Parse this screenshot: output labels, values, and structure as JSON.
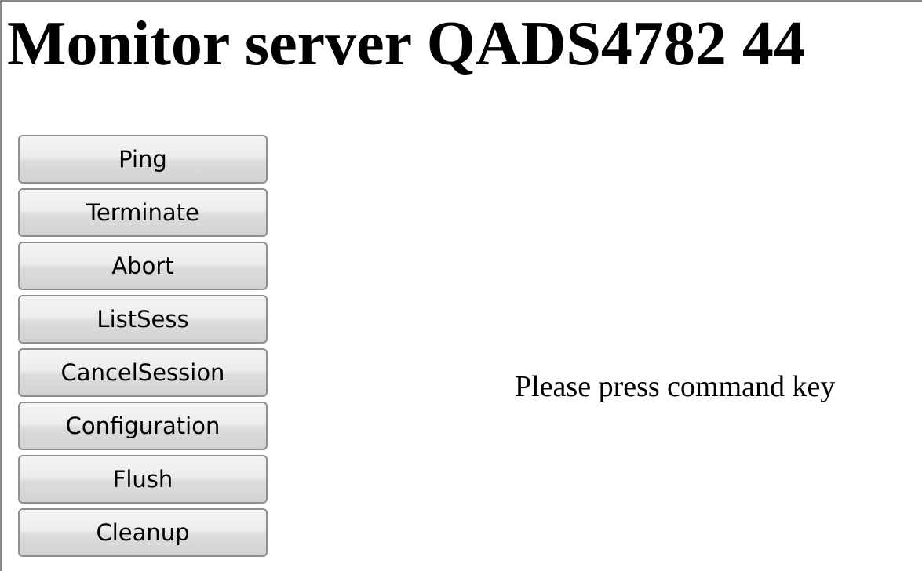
{
  "header": {
    "title": "Monitor server QADS4782 44"
  },
  "commands": {
    "ping": "Ping",
    "terminate": "Terminate",
    "abort": "Abort",
    "list_sess": "ListSess",
    "cancel_session": "CancelSession",
    "configuration": "Configuration",
    "flush": "Flush",
    "cleanup": "Cleanup"
  },
  "status": {
    "message": "Please press command key"
  }
}
